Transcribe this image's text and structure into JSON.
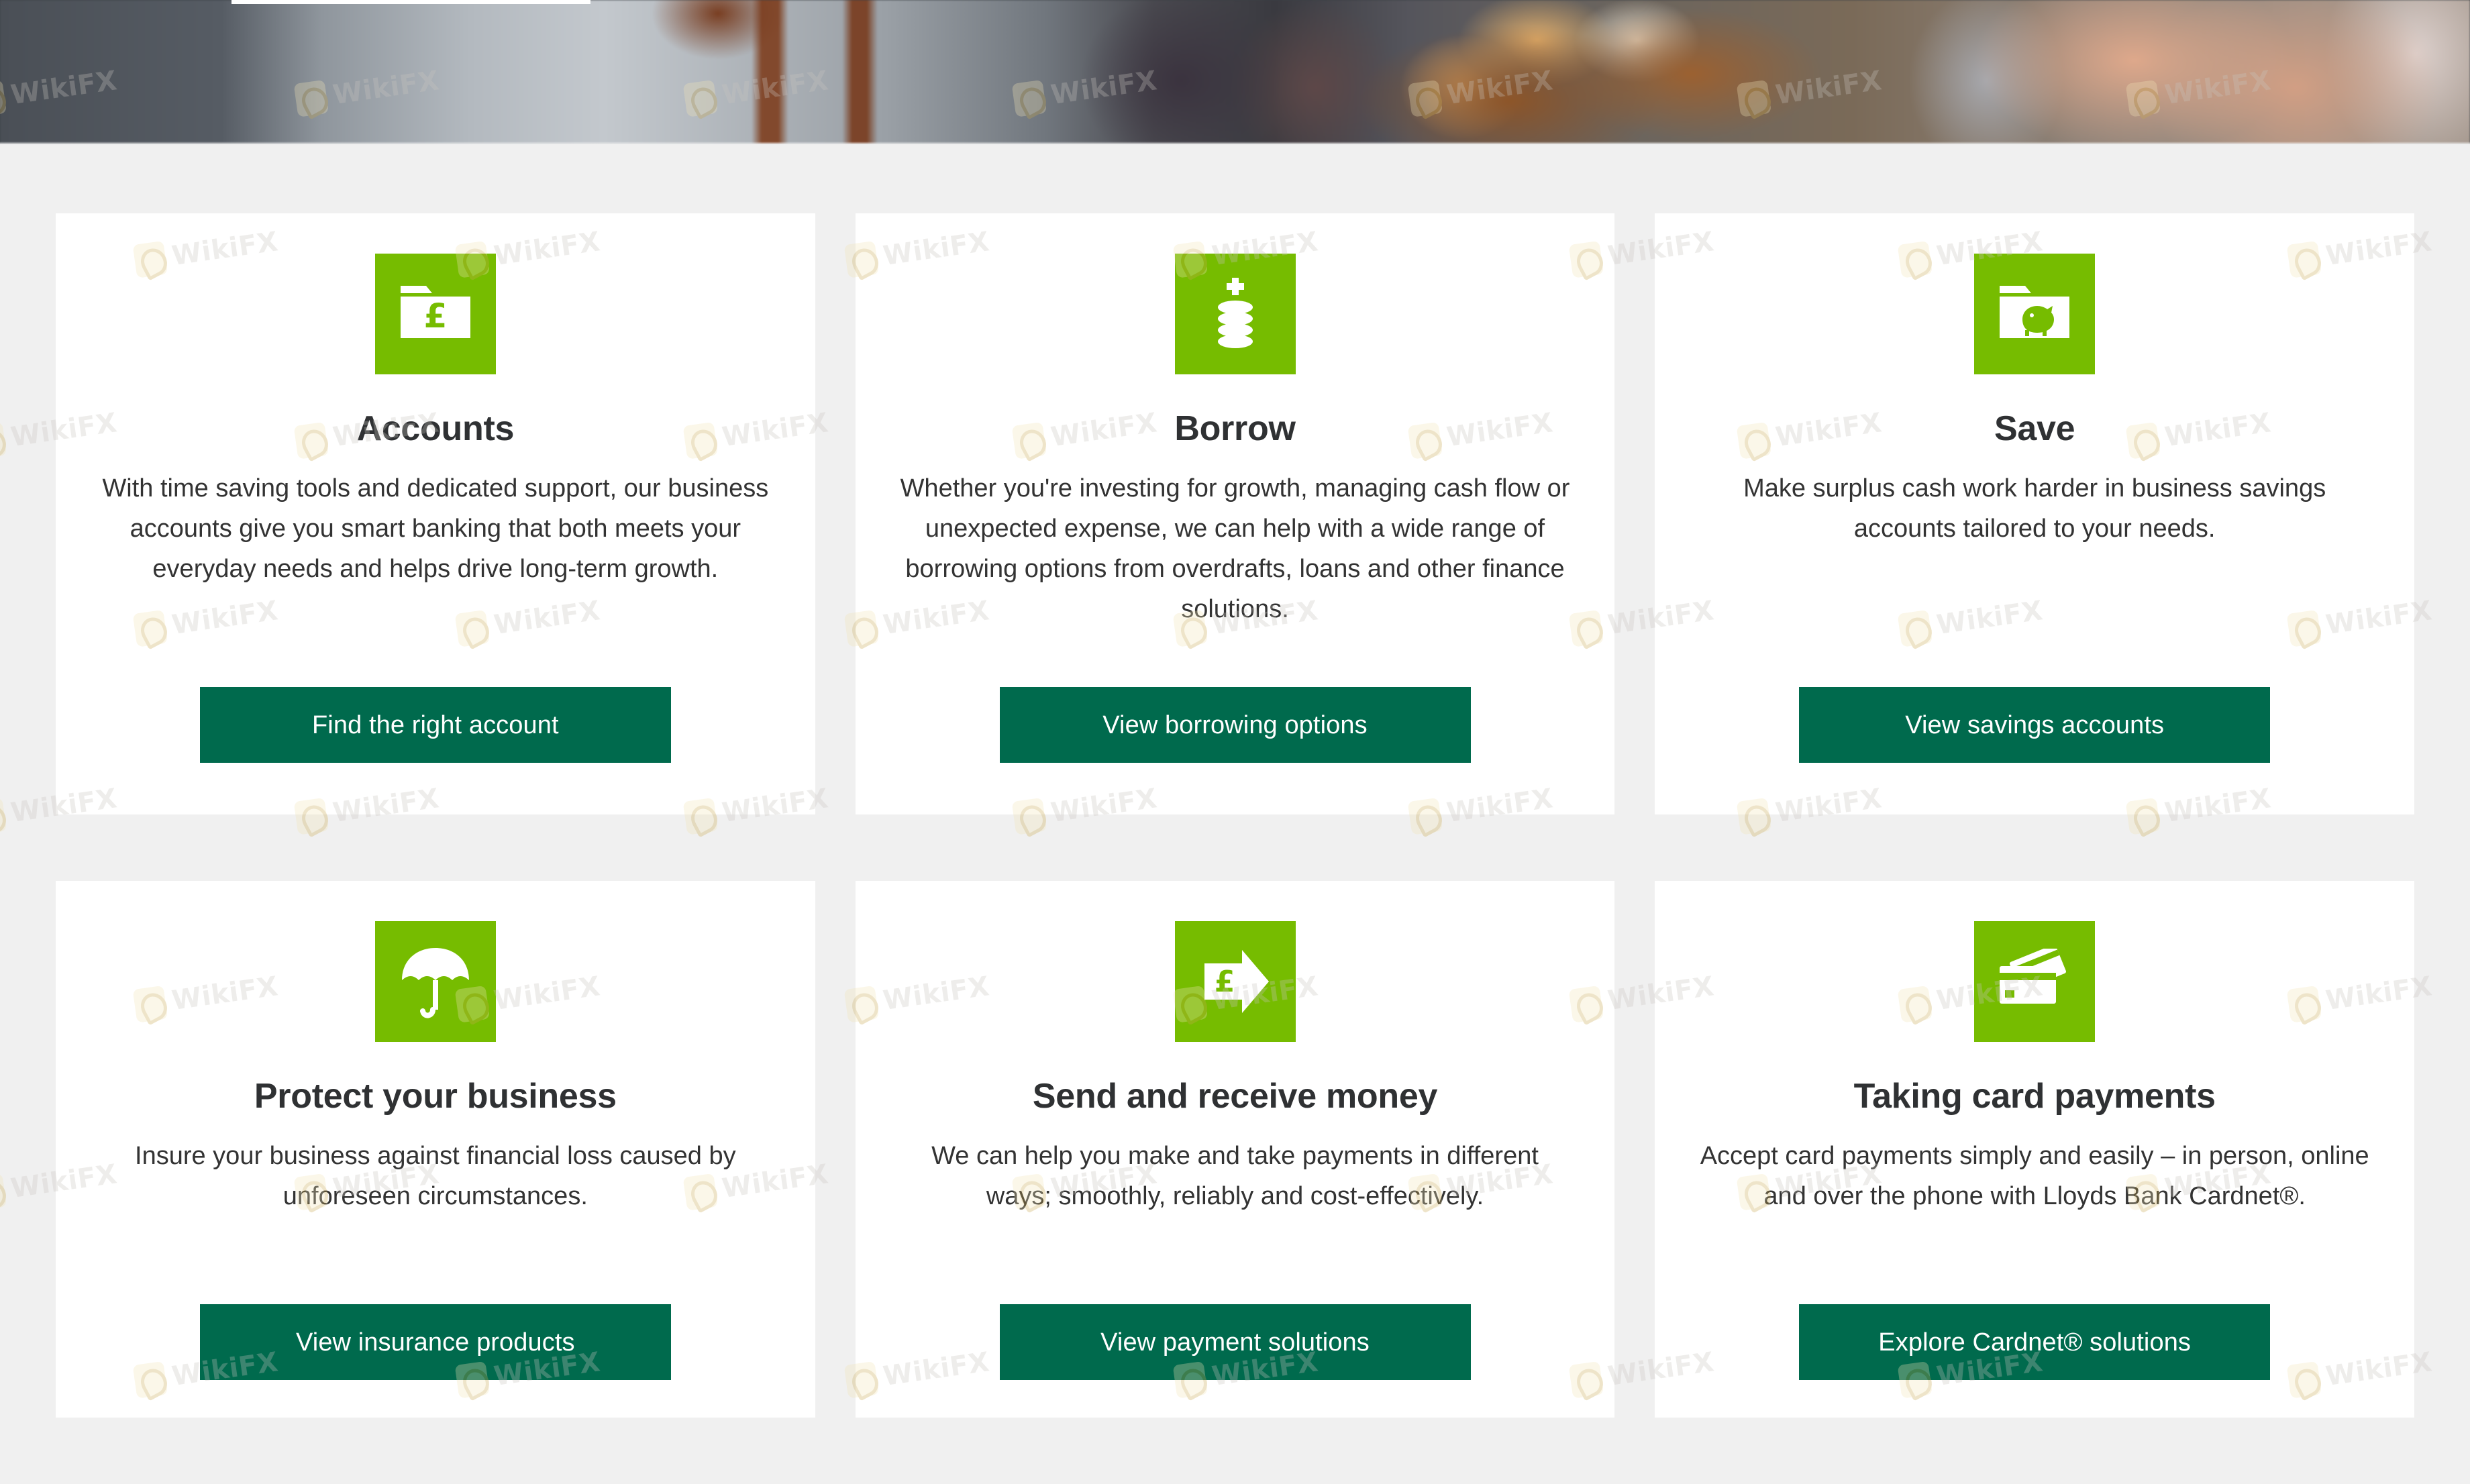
{
  "page": {
    "background_color": "#f0f0f0",
    "card_background": "#ffffff",
    "accent_green": "#76bc00",
    "button_green": "#006a4d",
    "title_color": "#2f3133",
    "body_color": "#333333"
  },
  "hero": {
    "alt": "Bakery counter with bread, packaged goods and a person using a laptop"
  },
  "watermark": {
    "text": "WikiFX"
  },
  "cards": [
    {
      "icon": "folder-pound-icon",
      "title": "Accounts",
      "description": "With time saving tools and dedicated support, our business accounts give you smart banking that both meets your everyday needs and helps drive long-term growth.",
      "cta": "Find the right account"
    },
    {
      "icon": "coin-stack-plus-icon",
      "title": "Borrow",
      "description": "Whether you're investing for growth, managing cash flow or unexpected expense, we can help with a wide range of borrowing options from overdrafts, loans and other finance solutions.",
      "cta": "View borrowing options"
    },
    {
      "icon": "folder-piggy-bank-icon",
      "title": "Save",
      "description": "Make surplus cash work harder in business savings accounts tailored to your needs.",
      "cta": "View savings accounts"
    },
    {
      "icon": "umbrella-icon",
      "title": "Protect your business",
      "description": "Insure your business against financial loss caused by unforeseen circumstances.",
      "cta": "View insurance products"
    },
    {
      "icon": "pound-arrow-right-icon",
      "title": "Send and receive money",
      "description": "We can help you make and take payments in different ways; smoothly, reliably and cost-effectively.",
      "cta": "View payment solutions"
    },
    {
      "icon": "credit-cards-icon",
      "title": "Taking card payments",
      "description": "Accept card payments simply and easily – in person, online and over the phone with Lloyds Bank Cardnet®.",
      "cta": "Explore Cardnet® solutions"
    }
  ]
}
